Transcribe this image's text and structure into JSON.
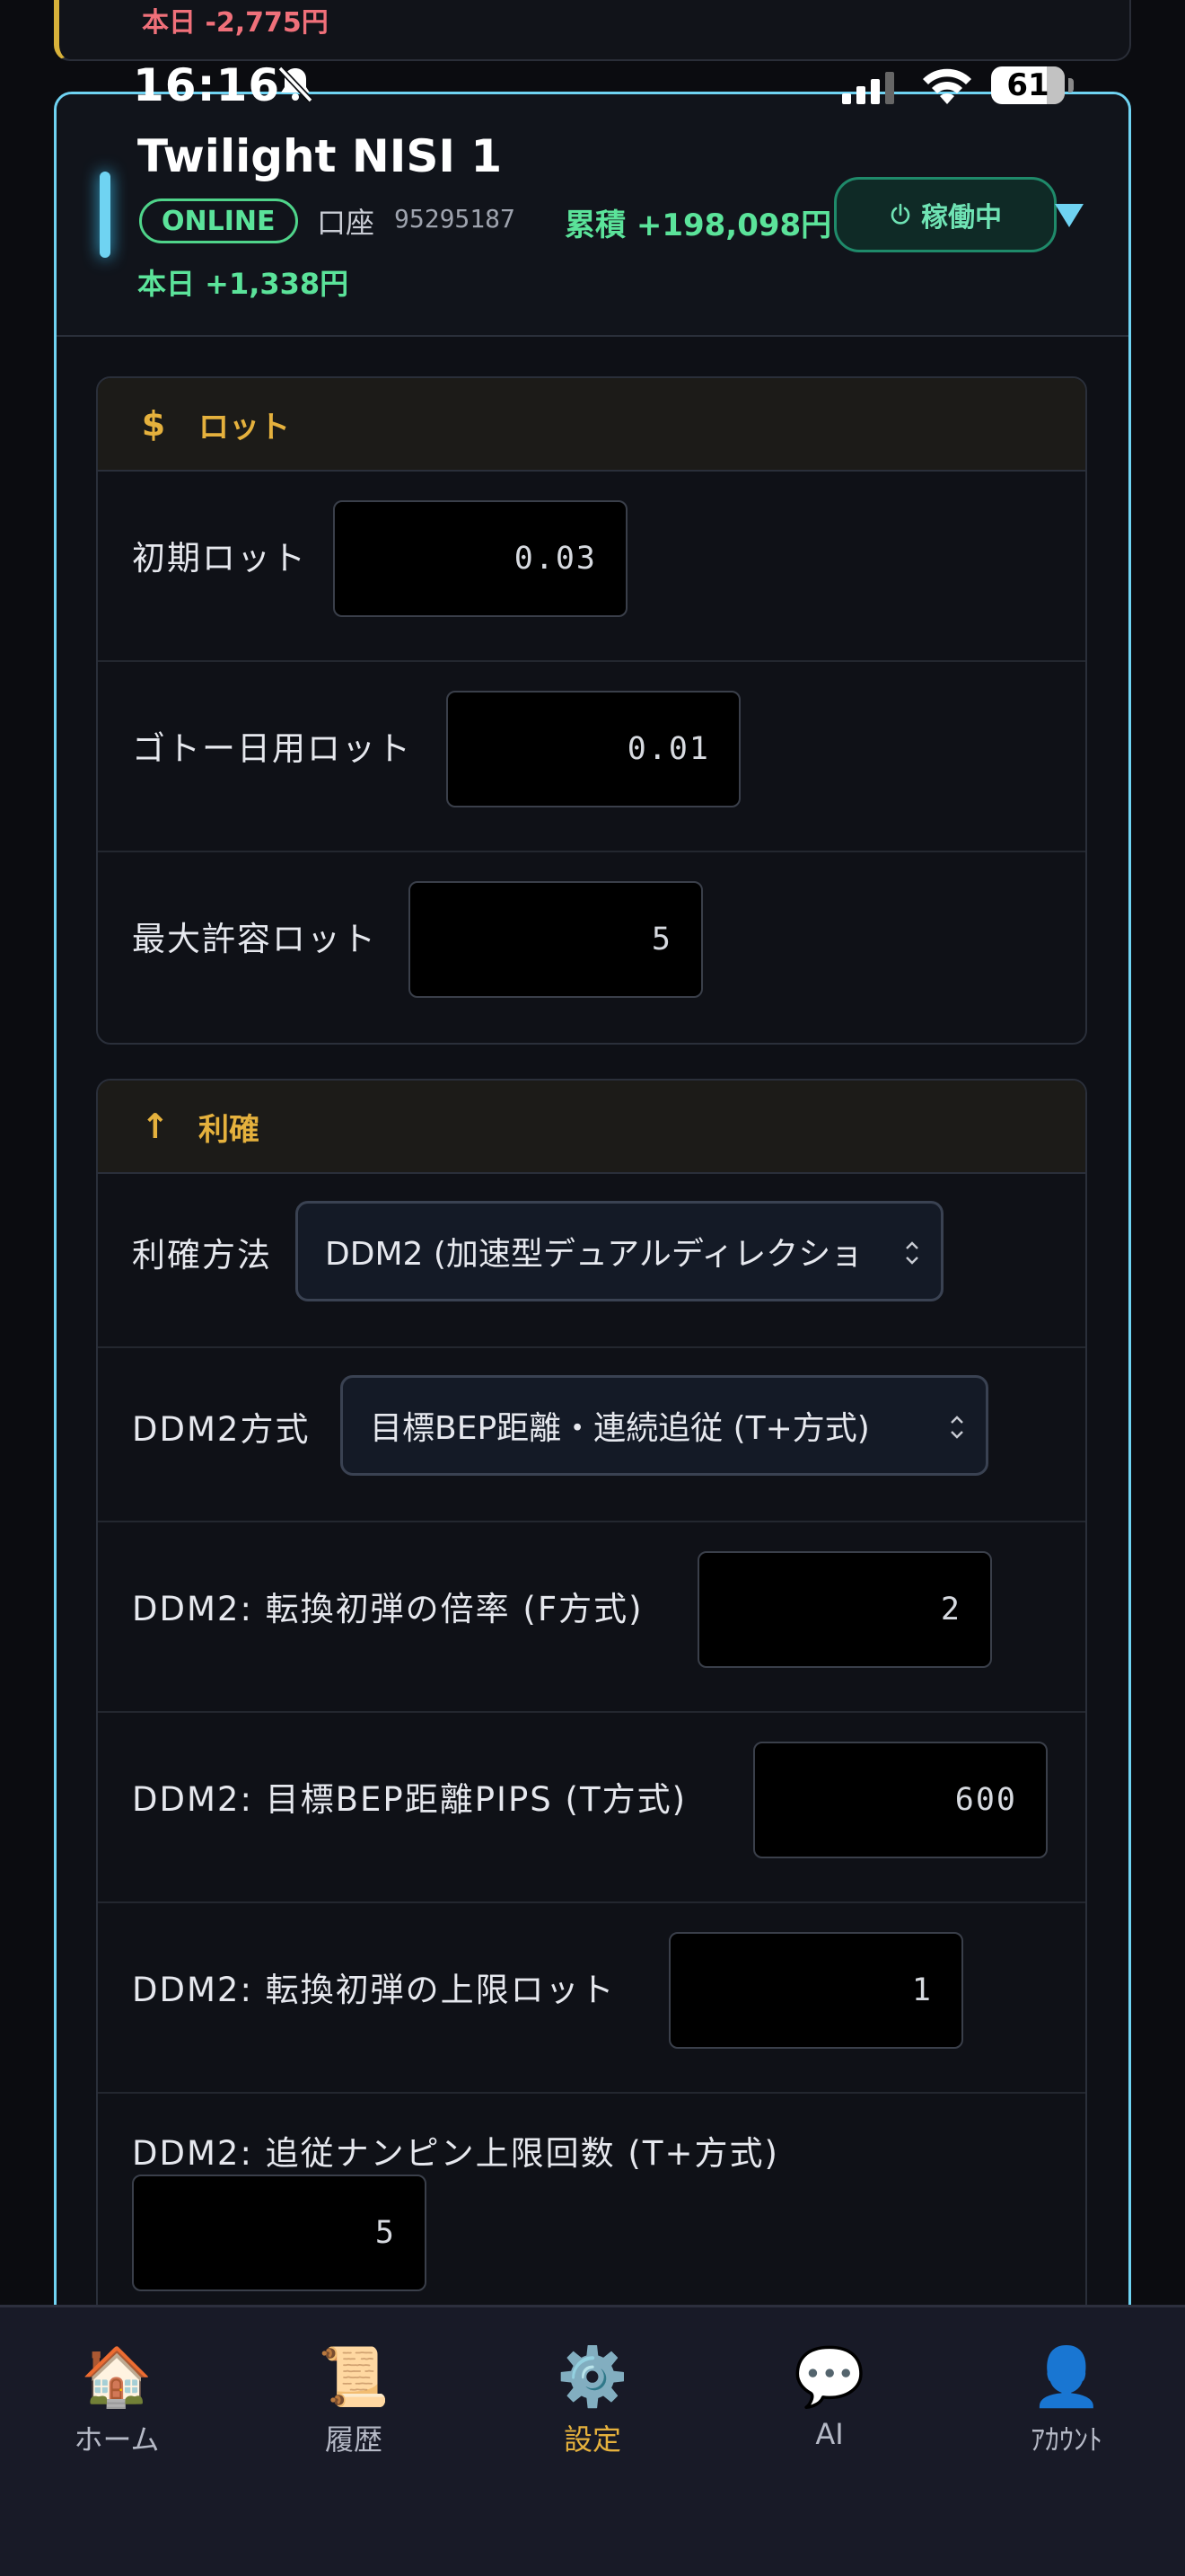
{
  "status_bar": {
    "time": "16:16",
    "battery": "61"
  },
  "previous_card": {
    "today_loss": "本日 -2,775円"
  },
  "bot": {
    "name": "Twilight NISI 1",
    "status_badge": "ONLINE",
    "account_label": "口座",
    "account_number": "95295187",
    "cumulative": "累積 +198,098円",
    "today": "本日 +1,338円",
    "running_button": "稼働中",
    "colors": {
      "accent": "#6fd3f2",
      "profit": "#5be39a",
      "loss": "#f0707a",
      "section": "#e5b13d"
    }
  },
  "lot_section": {
    "icon": "$",
    "title": "ロット",
    "rows": [
      {
        "label": "初期ロット",
        "value": "0.03"
      },
      {
        "label": "ゴトー日用ロット",
        "value": "0.01"
      },
      {
        "label": "最大許容ロット",
        "value": "5"
      }
    ]
  },
  "tp_section": {
    "icon": "↑",
    "title": "利確",
    "method": {
      "label": "利確方法",
      "value": "DDM2 (加速型デュアルディレクショ"
    },
    "ddm2_mode": {
      "label": "DDM2方式",
      "value": "目標BEP距離・連続追従 (T+方式)"
    },
    "rows": [
      {
        "label": "DDM2: 転換初弾の倍率 (F方式)",
        "value": "2"
      },
      {
        "label": "DDM2: 目標BEP距離PIPS (T方式)",
        "value": "600"
      },
      {
        "label": "DDM2: 転換初弾の上限ロット",
        "value": "1"
      },
      {
        "label": "DDM2: 追従ナンピン上限回数 (T+方式)",
        "value": "5"
      }
    ]
  },
  "bottom_nav": [
    {
      "label": "ホーム",
      "icon": "house-icon",
      "glyph": "🏠",
      "active": false
    },
    {
      "label": "履歴",
      "icon": "scroll-icon",
      "glyph": "📜",
      "active": false
    },
    {
      "label": "設定",
      "icon": "gear-icon",
      "glyph": "⚙️",
      "active": true
    },
    {
      "label": "AI",
      "icon": "chat-bubble-icon",
      "glyph": "💬",
      "active": false
    },
    {
      "label": "ｱｶｳﾝﾄ",
      "icon": "user-icon",
      "glyph": "👤",
      "active": false
    }
  ]
}
